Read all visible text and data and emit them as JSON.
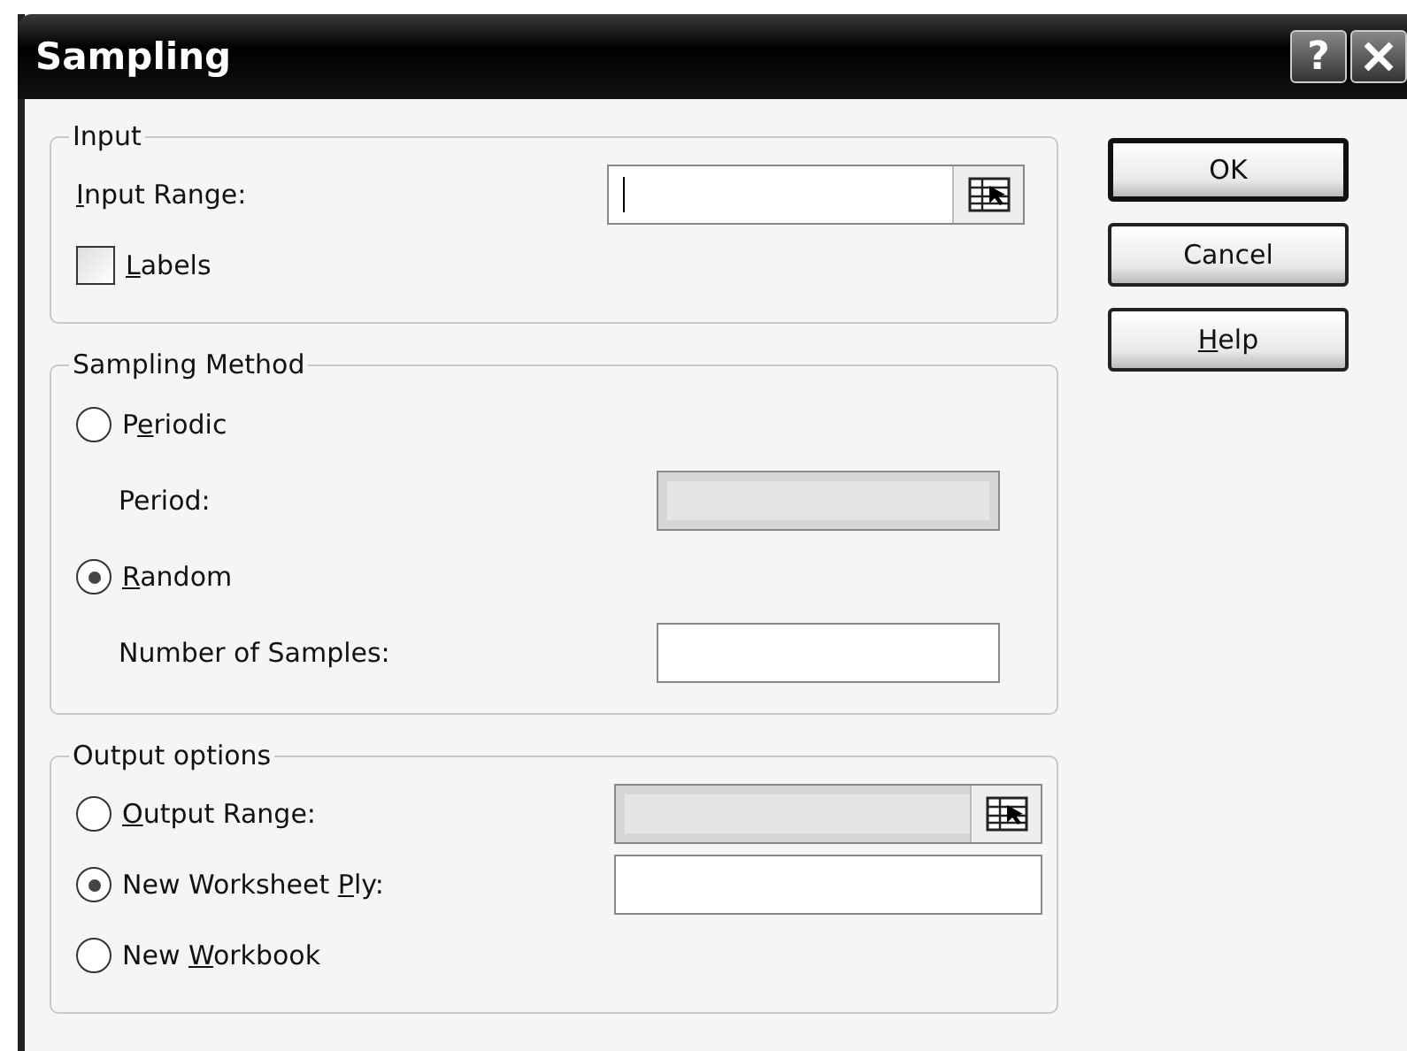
{
  "window": {
    "title": "Sampling",
    "title_buttons": [
      {
        "kind": "help",
        "label": "?"
      },
      {
        "kind": "close"
      }
    ]
  },
  "input": {
    "legend": "Input",
    "range_label": [
      {
        "text": "I",
        "underline": true
      },
      {
        "text": "nput Range:",
        "underline": false
      }
    ],
    "labels": {
      "label": [
        {
          "text": "L",
          "underline": true
        },
        {
          "text": "abels",
          "underline": false
        }
      ],
      "checked": false
    }
  },
  "sampling_method": {
    "legend": "Sampling Method",
    "options": [
      {
        "label": [
          {
            "text": "P",
            "underline": false
          },
          {
            "text": "e",
            "underline": true
          },
          {
            "text": "riodic",
            "underline": false
          }
        ],
        "selected": false,
        "field_label": "Period:",
        "field_disabled": true
      },
      {
        "label": [
          {
            "text": "R",
            "underline": true
          },
          {
            "text": "andom",
            "underline": false
          }
        ],
        "selected": true,
        "field_label": "Number of Samples:",
        "field_disabled": false
      }
    ]
  },
  "output_options": {
    "legend": "Output options",
    "options": [
      {
        "label": [
          {
            "text": "O",
            "underline": true
          },
          {
            "text": "utput Range:",
            "underline": false
          }
        ],
        "selected": false,
        "field": {
          "kind": "range",
          "disabled": true
        }
      },
      {
        "label": [
          {
            "text": "New Worksheet ",
            "underline": false
          },
          {
            "text": "P",
            "underline": true
          },
          {
            "text": "ly:",
            "underline": false
          }
        ],
        "selected": true,
        "field": {
          "kind": "text",
          "disabled": false
        }
      },
      {
        "label": [
          {
            "text": "New ",
            "underline": false
          },
          {
            "text": "W",
            "underline": true
          },
          {
            "text": "orkbook",
            "underline": false
          }
        ],
        "selected": false
      }
    ]
  },
  "buttons": [
    {
      "label": [
        {
          "text": "OK",
          "underline": false
        }
      ],
      "default": true
    },
    {
      "label": [
        {
          "text": "Cancel",
          "underline": false
        }
      ],
      "default": false
    },
    {
      "label": [
        {
          "text": "H",
          "underline": true
        },
        {
          "text": "elp",
          "underline": false
        }
      ],
      "default": false
    }
  ]
}
